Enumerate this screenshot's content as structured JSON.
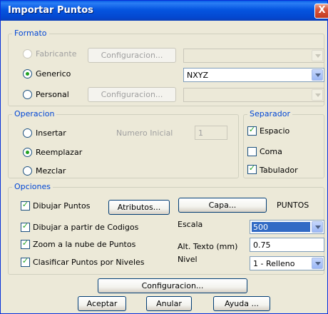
{
  "window": {
    "title": "Importar Puntos",
    "close_glyph": "X"
  },
  "formato": {
    "legend": "Formato",
    "fabricante": {
      "label": "Fabricante",
      "config_label": "Configuracion..."
    },
    "generico": {
      "label": "Generico",
      "value": "NXYZ"
    },
    "personal": {
      "label": "Personal",
      "config_label": "Configuracion..."
    }
  },
  "operacion": {
    "legend": "Operacion",
    "insertar": "Insertar",
    "numero_inicial_label": "Numero Inicial",
    "numero_inicial_value": "1",
    "reemplazar": "Reemplazar",
    "mezclar": "Mezclar"
  },
  "separador": {
    "legend": "Separador",
    "espacio": "Espacio",
    "coma": "Coma",
    "tabulador": "Tabulador"
  },
  "opciones": {
    "legend": "Opciones",
    "dibujar_puntos": "Dibujar Puntos",
    "atributos_label": "Atributos...",
    "capa_label": "Capa...",
    "capa_value": "PUNTOS",
    "dibujar_codigos": "Dibujar a partir de Codigos",
    "escala_label": "Escala",
    "escala_value": "500",
    "zoom": "Zoom a la nube de Puntos",
    "alt_texto_label": "Alt. Texto (mm)",
    "alt_texto_value": "0.75",
    "clasificar": "Clasificar Puntos por Niveles",
    "nivel_label": "Nivel",
    "nivel_value": "1 - Relleno"
  },
  "footer": {
    "configuracion_label": "Configuracion...",
    "aceptar_label": "Aceptar",
    "anular_label": "Anular",
    "ayuda_label": "Ayuda ..."
  },
  "colors": {
    "title_bar": "#0555e0",
    "legend_text": "#0046d5",
    "check_green": "#21a121",
    "dialog_bg": "#ece9d8"
  }
}
